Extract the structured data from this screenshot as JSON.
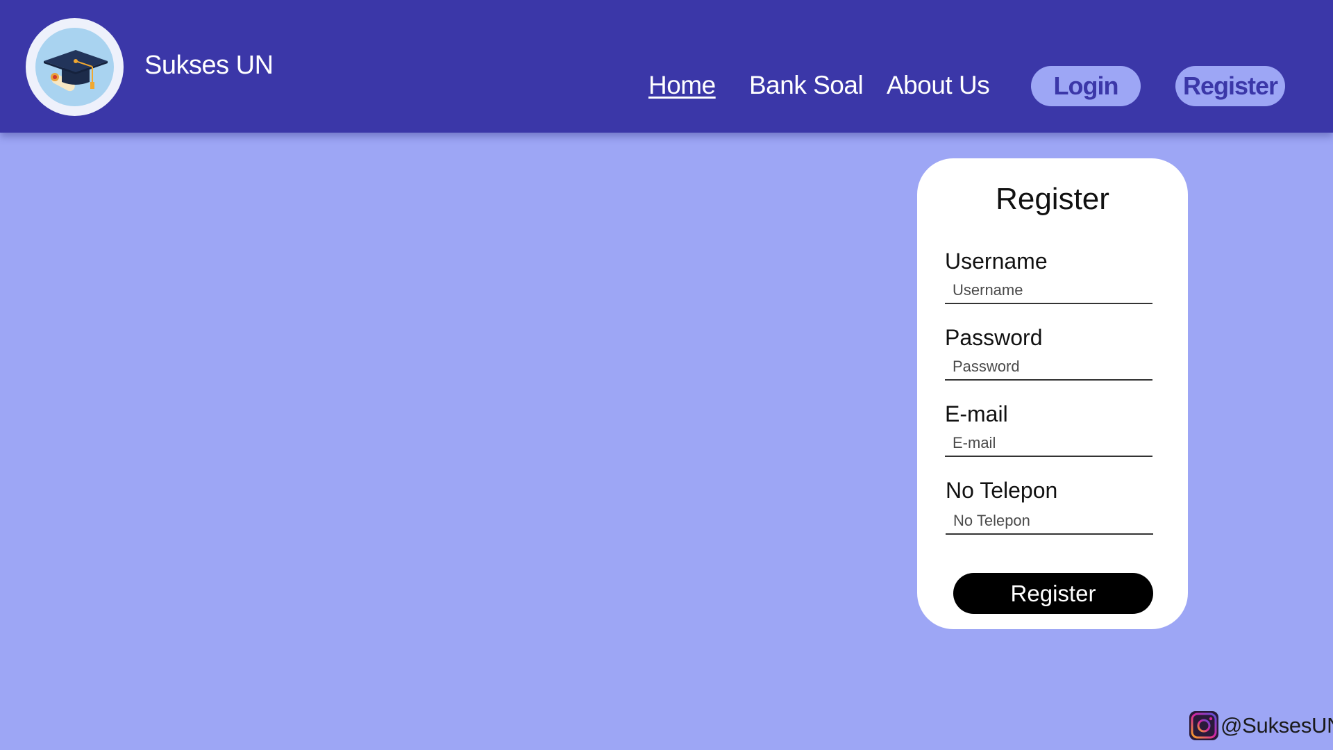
{
  "header": {
    "logo_icon": "graduation-cap-icon",
    "brand_name": "Sukses UN",
    "nav": [
      {
        "label": "Home",
        "active": true
      },
      {
        "label": "Bank Soal",
        "active": false
      },
      {
        "label": "About Us",
        "active": false
      }
    ],
    "login_label": "Login",
    "register_label": "Register"
  },
  "form": {
    "title": "Register",
    "fields": [
      {
        "label": "Username",
        "placeholder": "Username"
      },
      {
        "label": "Password",
        "placeholder": "Password"
      },
      {
        "label": "E-mail",
        "placeholder": "E-mail"
      },
      {
        "label": "No Telepon",
        "placeholder": "No Telepon"
      }
    ],
    "submit_label": "Register"
  },
  "footer": {
    "social_icon": "instagram-icon",
    "handle": "@SuksesUN"
  },
  "colors": {
    "header_bg": "#3b37a8",
    "page_bg": "#9da6f5",
    "pill_bg": "#9da6f5",
    "pill_text": "#3b37a8",
    "submit_bg": "#000000"
  }
}
